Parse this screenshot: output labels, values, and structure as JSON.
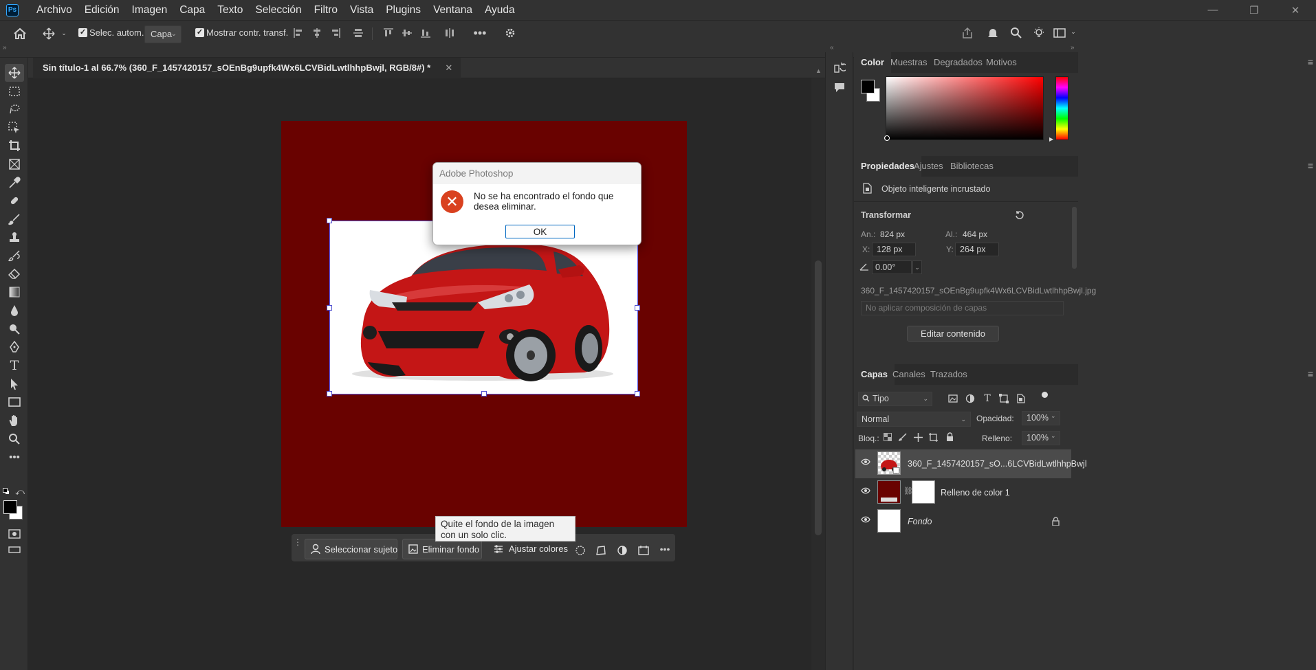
{
  "menubar": {
    "app_badge": "Ps",
    "menus": [
      "Archivo",
      "Edición",
      "Imagen",
      "Capa",
      "Texto",
      "Selección",
      "Filtro",
      "Vista",
      "Plugins",
      "Ventana",
      "Ayuda"
    ]
  },
  "options": {
    "auto_select_label": "Selec. autom.:",
    "auto_select_value": "Capa",
    "show_transform_label": "Mostrar contr. transf."
  },
  "document": {
    "tab_title": "Sin título-1 al 66.7% (360_F_1457420157_sOEnBg9upfk4Wx6LCVBidLwtlhhpBwjl, RGB/8#) *",
    "background_color": "#690200"
  },
  "dialog": {
    "title": "Adobe Photoshop",
    "message": "No se ha encontrado el fondo que desea eliminar.",
    "ok_label": "OK"
  },
  "context_bar": {
    "select_subject": "Seleccionar sujeto",
    "remove_bg": "Eliminar fondo",
    "adjust_colors": "Ajustar colores",
    "tooltip": "Quite el fondo de la imagen con un solo clic."
  },
  "color_panel": {
    "tabs": [
      "Color",
      "Muestras",
      "Degradados",
      "Motivos"
    ],
    "active_tab": "Color",
    "foreground": "#000000",
    "background": "#ffffff",
    "hue_color": "#ff0000"
  },
  "properties_panel": {
    "tabs": [
      "Propiedades",
      "Ajustes",
      "Bibliotecas"
    ],
    "object_type": "Objeto inteligente incrustado",
    "section": "Transformar",
    "w_label": "An.:",
    "w_value": "824 px",
    "h_label": "Al.:",
    "h_value": "464 px",
    "x_label": "X:",
    "x_value": "128 px",
    "y_label": "Y:",
    "y_value": "264 px",
    "angle_value": "0.00°",
    "filename": "360_F_1457420157_sOEnBg9upfk4Wx6LCVBidLwtlhhpBwjl.jpg",
    "comp_placeholder": "No aplicar composición de capas",
    "edit_button": "Editar contenido"
  },
  "layers_panel": {
    "tabs": [
      "Capas",
      "Canales",
      "Trazados"
    ],
    "filter_label": "Tipo",
    "blend_mode": "Normal",
    "opacity_label": "Opacidad:",
    "opacity_value": "100%",
    "lock_label": "Bloq.:",
    "fill_label": "Relleno:",
    "fill_value": "100%",
    "layers": [
      {
        "name": "360_F_1457420157_sO...6LCVBidLwtlhhpBwjl",
        "selected": true
      },
      {
        "name": "Relleno de color 1",
        "selected": false
      },
      {
        "name": "Fondo",
        "selected": false
      }
    ]
  }
}
